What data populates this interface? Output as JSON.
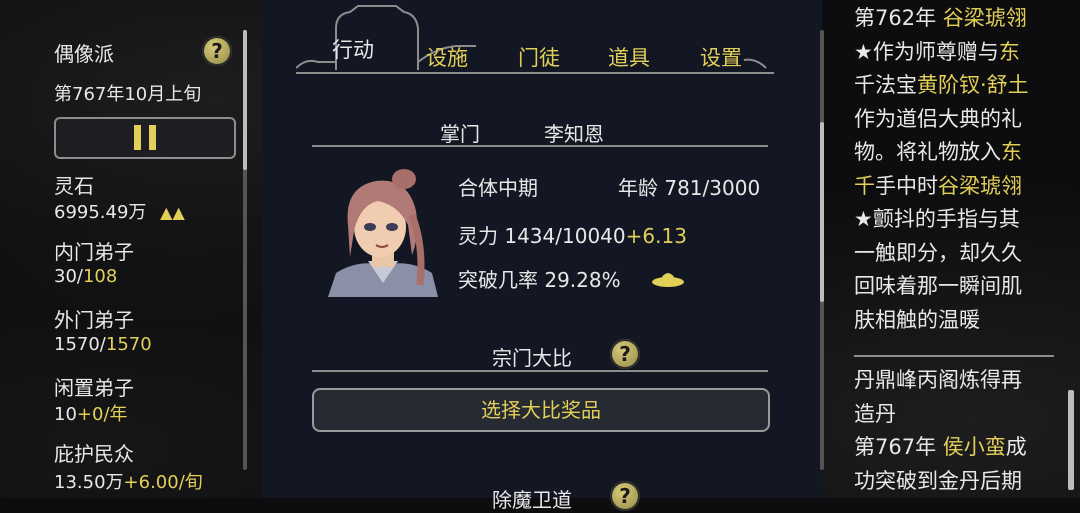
{
  "left": {
    "sect_type": "偶像派",
    "date": "第767年10月上旬",
    "stats": [
      {
        "label": "灵石",
        "value": "6995.49万",
        "value_gold": "",
        "arrows": "▲▲"
      },
      {
        "label": "内门弟子",
        "value": "30/",
        "value_gold": "108"
      },
      {
        "label": "外门弟子",
        "value": "1570/",
        "value_gold": "1570"
      },
      {
        "label": "闲置弟子",
        "value": "10",
        "value_gold": "+0/年"
      },
      {
        "label": "庇护民众",
        "value": "13.50万",
        "value_gold": "+6.00/旬"
      }
    ]
  },
  "tabs": [
    {
      "label": "行动",
      "active": true
    },
    {
      "label": "设施",
      "active": false
    },
    {
      "label": "门徒",
      "active": false
    },
    {
      "label": "道具",
      "active": false
    },
    {
      "label": "设置",
      "active": false
    }
  ],
  "leader": {
    "title_label": "掌门",
    "name": "李知恩",
    "realm": "合体中期",
    "age_label": "年龄",
    "age_value": "781/3000",
    "spirit_label": "灵力",
    "spirit_value": "1434/10040",
    "spirit_rate": "+6.13",
    "breakthrough_label": "突破几率",
    "breakthrough_value": "29.28%"
  },
  "competition": {
    "title": "宗门大比",
    "button_label": "选择大比奖品"
  },
  "next_section": {
    "title": "除魔卫道"
  },
  "log": {
    "lines": [
      [
        {
          "t": "第762年 ",
          "gold": false
        },
        {
          "t": "谷梁琥翎",
          "gold": true
        }
      ],
      [
        {
          "t": "★作为师尊赠与",
          "gold": false
        },
        {
          "t": "东",
          "gold": true
        }
      ],
      [
        {
          "t": "千法宝",
          "gold": false
        },
        {
          "t": "黄阶钗·舒土",
          "gold": true
        }
      ],
      [
        {
          "t": "作为道侣大典的礼",
          "gold": false
        }
      ],
      [
        {
          "t": "物。将礼物放入",
          "gold": false
        },
        {
          "t": "东",
          "gold": true
        }
      ],
      [
        {
          "t": "千",
          "gold": true
        },
        {
          "t": "手中时",
          "gold": false
        },
        {
          "t": "谷梁琥翎",
          "gold": true
        }
      ],
      [
        {
          "t": "★颤抖的手指与其",
          "gold": false
        }
      ],
      [
        {
          "t": "一触即分，却久久",
          "gold": false
        }
      ],
      [
        {
          "t": "回味着那一瞬间肌",
          "gold": false
        }
      ],
      [
        {
          "t": "肤相触的温暖",
          "gold": false
        }
      ]
    ],
    "lines2": [
      [
        {
          "t": "丹鼎峰丙阁炼得再",
          "gold": false
        }
      ],
      [
        {
          "t": "造丹",
          "gold": false
        }
      ],
      [
        {
          "t": "第767年 ",
          "gold": false
        },
        {
          "t": "侯小蛮",
          "gold": true
        },
        {
          "t": "成",
          "gold": false
        }
      ],
      [
        {
          "t": "功突破到金丹后期",
          "gold": false
        }
      ]
    ]
  },
  "colors": {
    "gold": "#e2cf58",
    "text": "#e8e8e8",
    "panel": "#121723"
  }
}
